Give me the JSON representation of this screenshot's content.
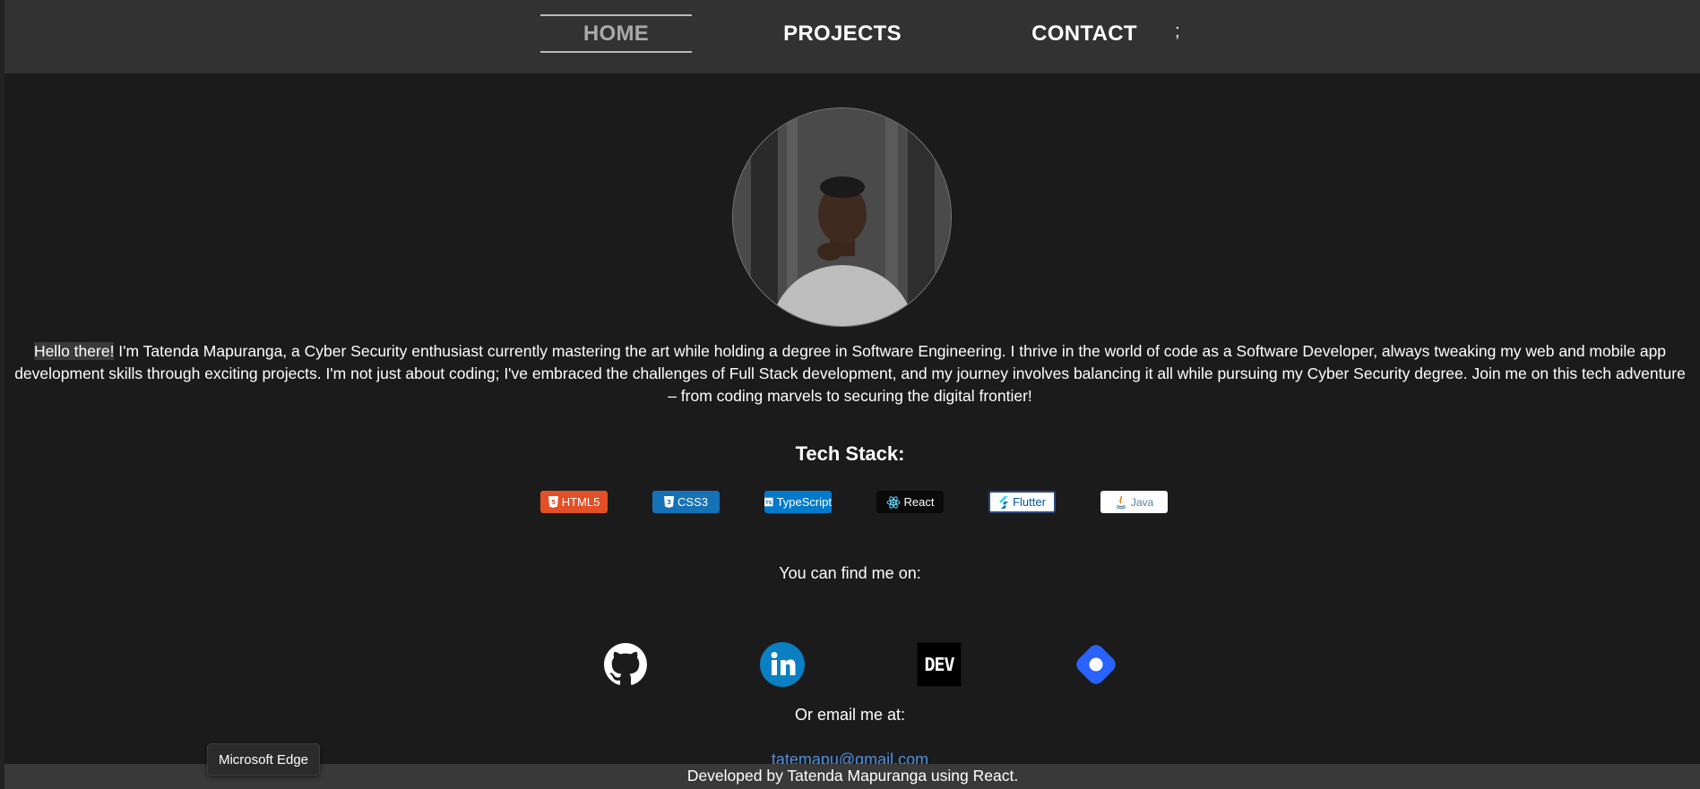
{
  "nav": {
    "home": "HOME",
    "projects": "PROJECTS",
    "contact": "CONTACT",
    "extra": ";"
  },
  "bio": {
    "greeting": "Hello there!",
    "text": " I'm Tatenda Mapuranga, a Cyber Security enthusiast currently mastering the art while holding a degree in Software Engineering. I thrive in the world of code as a Software Developer, always tweaking my web and mobile app development skills through exciting projects. I'm not just about coding; I've embraced the challenges of Full Stack development, and my journey involves balancing it all while pursuing my Cyber Security degree. Join me on this tech adventure – from coding marvels to securing the digital frontier!"
  },
  "tech_stack": {
    "title": "Tech Stack:",
    "badges": [
      {
        "label": "HTML5",
        "icon": "html5-icon",
        "color": "#e34f26"
      },
      {
        "label": "CSS3",
        "icon": "css3-icon",
        "color": "#1572b6"
      },
      {
        "label": "TypeScript",
        "icon": "typescript-icon",
        "color": "#007acc"
      },
      {
        "label": "React",
        "icon": "react-icon",
        "color": "#0a0a0a"
      },
      {
        "label": "Flutter",
        "icon": "flutter-icon",
        "color": "#ffffff"
      },
      {
        "label": "Java",
        "icon": "java-icon",
        "color": "#ffffff"
      }
    ]
  },
  "social": {
    "heading": "You can find me on:",
    "links": [
      {
        "name": "github",
        "icon": "github-icon"
      },
      {
        "name": "linkedin",
        "icon": "linkedin-icon"
      },
      {
        "name": "dev",
        "icon": "dev-icon",
        "text": "DEV"
      },
      {
        "name": "hashnode",
        "icon": "hashnode-icon"
      }
    ]
  },
  "email": {
    "heading": "Or email me at:",
    "address": "tatemapu@gmail.com"
  },
  "footer": {
    "text": "Developed by Tatenda Mapuranga using React."
  },
  "tooltip": {
    "text": "Microsoft Edge"
  },
  "colors": {
    "background": "#1c1b1c",
    "navbar": "#333233",
    "link": "#4e8fe0"
  }
}
